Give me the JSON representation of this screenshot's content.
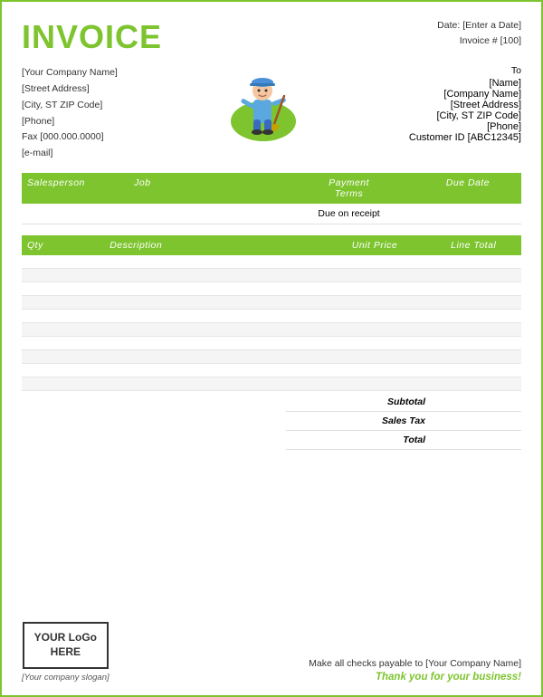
{
  "header": {
    "title": "INVOICE",
    "date_label": "Date:",
    "date_value": "[Enter a Date]",
    "invoice_label": "Invoice #",
    "invoice_number": "[100]"
  },
  "from": {
    "company": "[Your Company Name]",
    "address": "[Street Address]",
    "citystatezip": "[City, ST  ZIP Code]",
    "phone": "[Phone]",
    "fax": "Fax [000.000.0000]",
    "email": "[e-mail]"
  },
  "to_label": "To",
  "to": {
    "name": "[Name]",
    "company": "[Company Name]",
    "address": "[Street Address]",
    "citystatezip": "[City, ST  ZIP Code]",
    "phone": "[Phone]",
    "customer_id": "Customer ID [ABC12345]"
  },
  "table_top": {
    "headers": {
      "salesperson": "Salesperson",
      "job": "Job",
      "payment_terms": "Payment\nTerms",
      "due_date": "Due Date"
    },
    "row": {
      "salesperson": "",
      "job": "",
      "payment_terms": "Due on receipt",
      "due_date": ""
    }
  },
  "table_items": {
    "headers": {
      "qty": "Qty",
      "description": "Description",
      "unit_price": "Unit Price",
      "line_total": "Line Total"
    },
    "rows": [
      {
        "qty": "",
        "description": "",
        "unit_price": "",
        "line_total": ""
      },
      {
        "qty": "",
        "description": "",
        "unit_price": "",
        "line_total": ""
      },
      {
        "qty": "",
        "description": "",
        "unit_price": "",
        "line_total": ""
      },
      {
        "qty": "",
        "description": "",
        "unit_price": "",
        "line_total": ""
      },
      {
        "qty": "",
        "description": "",
        "unit_price": "",
        "line_total": ""
      },
      {
        "qty": "",
        "description": "",
        "unit_price": "",
        "line_total": ""
      },
      {
        "qty": "",
        "description": "",
        "unit_price": "",
        "line_total": ""
      },
      {
        "qty": "",
        "description": "",
        "unit_price": "",
        "line_total": ""
      },
      {
        "qty": "",
        "description": "",
        "unit_price": "",
        "line_total": ""
      },
      {
        "qty": "",
        "description": "",
        "unit_price": "",
        "line_total": ""
      }
    ]
  },
  "totals": {
    "subtotal_label": "Subtotal",
    "subtotal_value": "",
    "salestax_label": "Sales Tax",
    "salestax_value": "",
    "total_label": "Total",
    "total_value": ""
  },
  "footer": {
    "logo_line1": "YOUR LoGo",
    "logo_line2": "HERE",
    "slogan": "[Your company slogan]",
    "checks": "Make all checks payable to [Your Company Name]",
    "thankyou": "Thank you for your business!"
  },
  "colors": {
    "green": "#7dc42e"
  }
}
